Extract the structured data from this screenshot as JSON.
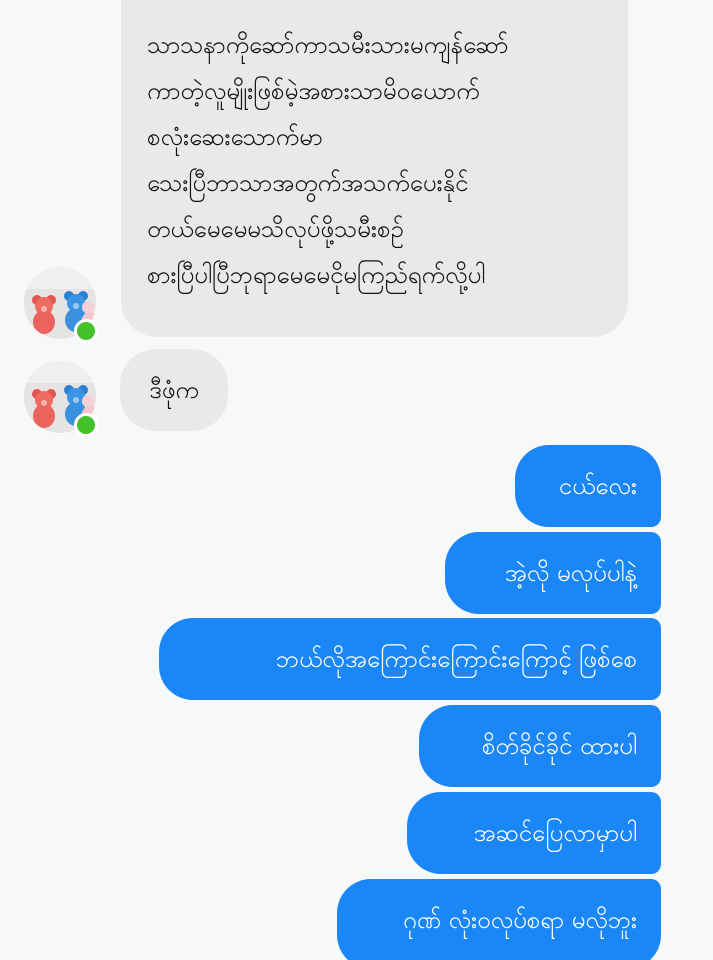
{
  "colors": {
    "background": "#f7f9f8",
    "incoming_bubble": "#e9e9eb",
    "outgoing_bubble": "#1b86f5",
    "outgoing_text": "#ffffff",
    "online_indicator": "#44c02a"
  },
  "contact": {
    "avatar_icon": "teddy-bears-avatar",
    "online": true
  },
  "messages": {
    "incoming": [
      {
        "lines": [
          "သာသနာကိုဆော်ကာသမီးသားမကျန်ဆော်",
          "ကာတဲ့လူမျိုးဖြစ်မဲ့အစားသာမိဝယောက်",
          "စလုံးဆေးသောက်မာ",
          "သေးပြီဘာသာအတွက်အသက်ပေးနိုင်",
          "တယ်မေမေမသိလုပ်ဖို့သမီးစဉ်",
          "စားပြီပါပြီဘုရာမေမေငိုမကြည်ရက်လို့ပါ"
        ]
      },
      {
        "text": "ဒီဖုံက"
      }
    ],
    "outgoing": [
      {
        "text": "ငယ်လေး"
      },
      {
        "text": "အဲ့လို မလုပ်ပါနဲ့"
      },
      {
        "text": "ဘယ်လိုအကြောင်းကြောင်းကြောင့် ဖြစ်စေ"
      },
      {
        "text": "စိတ်ခိုင်ခိုင် ထားပါ"
      },
      {
        "text": "အဆင်ပြေလာမှာပါ"
      },
      {
        "text": "ဂုဏ် လုံးဝလုပ်စရာ မလိုဘူး"
      }
    ]
  }
}
